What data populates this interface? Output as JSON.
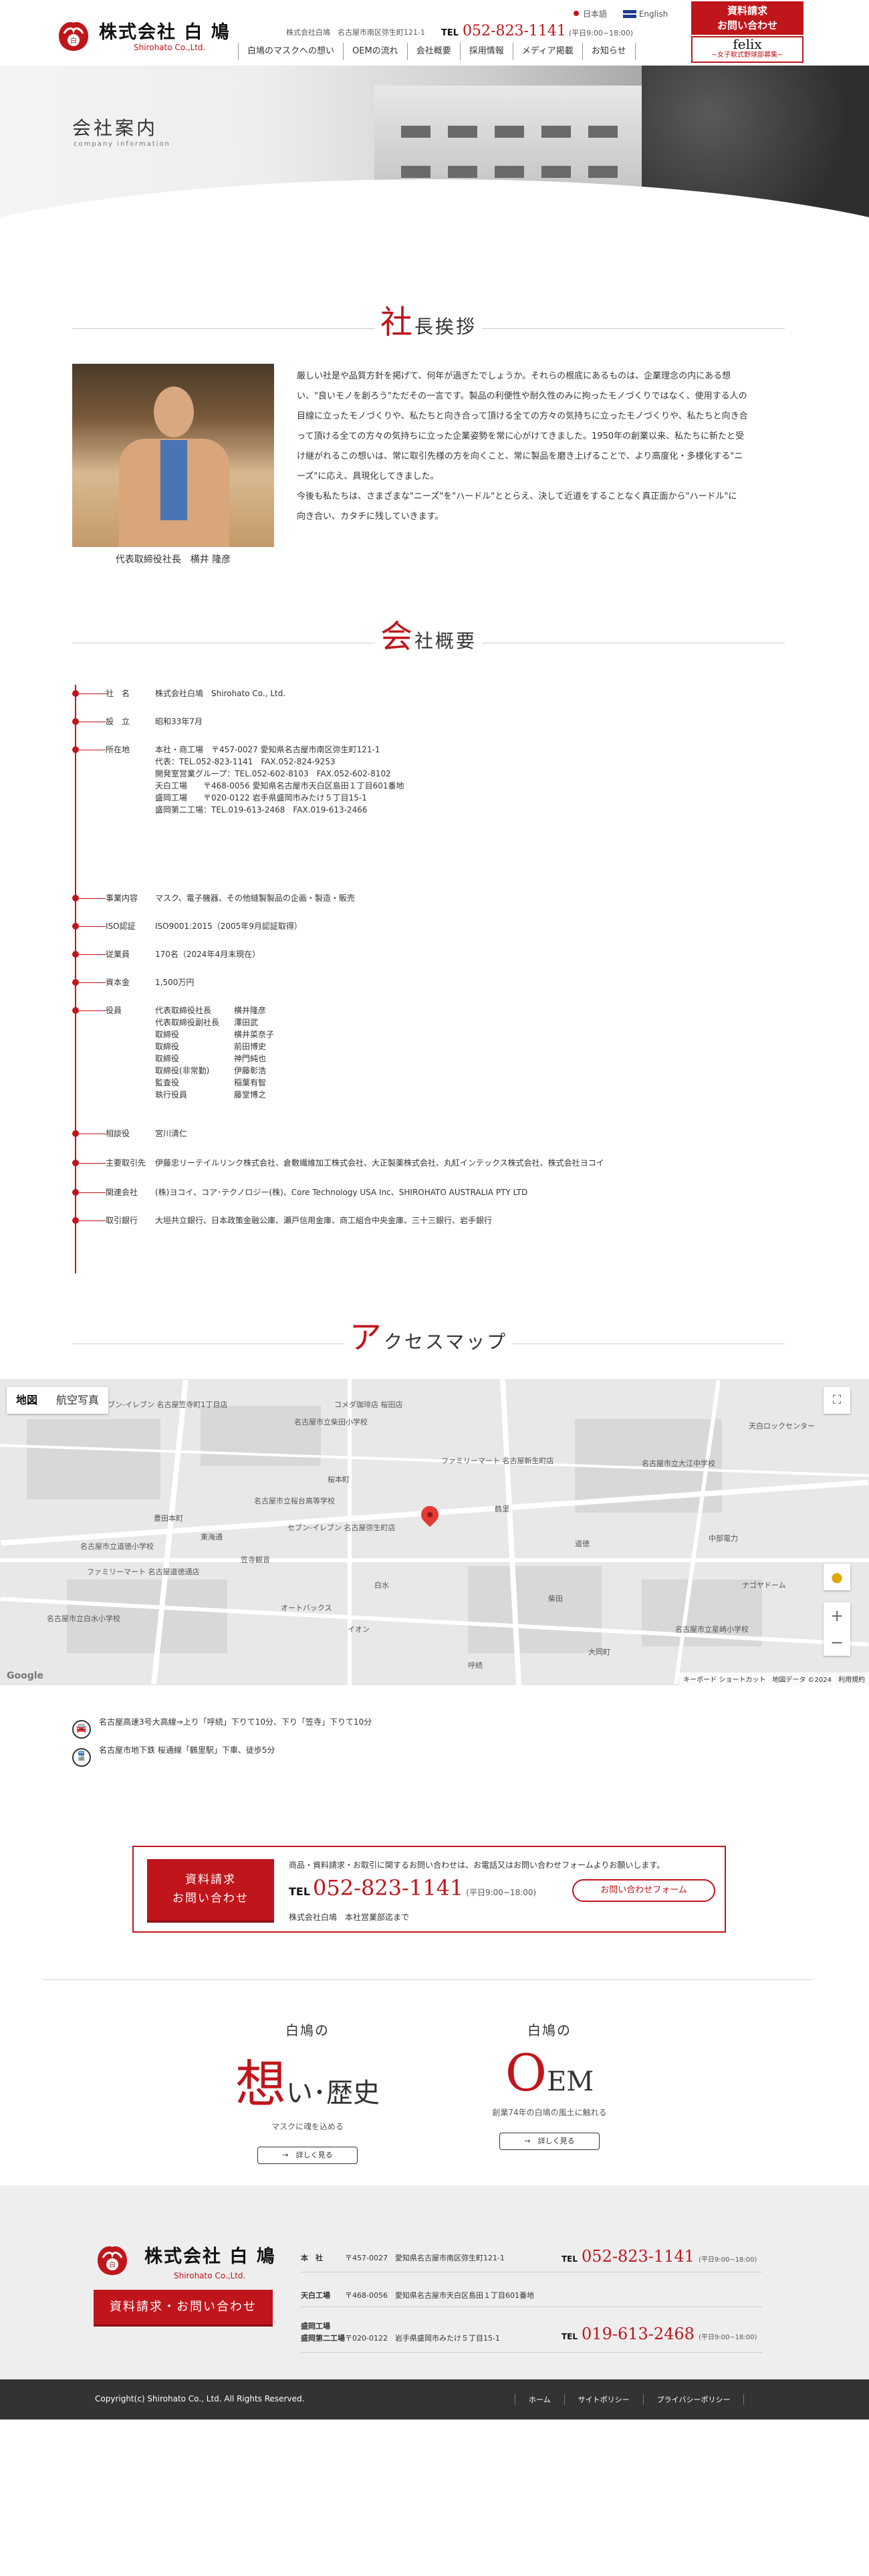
{
  "header": {
    "company_name": "株式会社 白 鳩",
    "company_name_en": "Shirohato Co.,Ltd.",
    "lang_ja": "日本語",
    "lang_en": "English",
    "address": "株式会社白鳩　名古屋市南区弥生町121-1",
    "tel_label": "TEL",
    "tel": "052-823-1141",
    "tel_hours": "(平日9:00~18:00)",
    "cta_line1": "資料請求",
    "cta_line2": "お問い合わせ",
    "felix_title": "felix",
    "felix_sub": "~女子軟式野球部募集~",
    "nav": [
      "白鳩のマスクへの想い",
      "OEMの流れ",
      "会社概要",
      "採用情報",
      "メディア掲載",
      "お知らせ"
    ]
  },
  "hero": {
    "title": "会社案内",
    "subtitle": "company information"
  },
  "greeting": {
    "heading_initial": "社",
    "heading_rest": "長挨拶",
    "caption": "代表取締役社長　横井 隆彦",
    "lines": [
      "厳しい社是や品質方針を掲げて、何年が過ぎたでしょうか。それらの根底にあるものは、企業理念の内にある想",
      "い、\"良いモノを創ろう\"ただその一言です。製品の利便性や耐久性のみに拘ったモノづくりではなく、使用する人の",
      "目線に立ったモノづくりや、私たちと向き合って頂ける全ての方々の気持ちに立ったモノづくりや、私たちと向き合",
      "って頂ける全ての方々の気持ちに立った企業姿勢を常に心がけてきました。1950年の創業以来、私たちに新たと受",
      "け継がれるこの想いは、常に取引先様の方を向くこと、常に製品を磨き上げることで、より高度化・多様化する\"ニ",
      "ーズ\"に応え、具現化してきました。",
      "今後も私たちは、さまざまな\"ニーズ\"を\"ハードル\"ととらえ、決して近道をすることなく真正面から\"ハードル\"に",
      "向き合い、カタチに残していきます。"
    ]
  },
  "overview": {
    "heading_initial": "会",
    "heading_rest": "社概要",
    "rows": [
      {
        "k": "社　名",
        "v": [
          "株式会社白鳩　Shirohato Co., Ltd."
        ]
      },
      {
        "k": "設　立",
        "v": [
          "昭和33年7月"
        ]
      },
      {
        "k": "所在地",
        "v": [
          "本社・商工場　〒457-0027 愛知県名古屋市南区弥生町121-1",
          "代表：TEL.052-823-1141　FAX.052-824-9253",
          "開発室営業グループ：TEL.052-602-8103　FAX.052-602-8102",
          "",
          "天白工場　　〒468-0056 愛知県名古屋市天白区島田１丁目601番地",
          "",
          "盛岡工場　　〒020-0122 岩手県盛岡市みたけ５丁目15-1",
          "盛岡第二工場：TEL.019-613-2468　FAX.019-613-2466"
        ]
      },
      {
        "k": "事業内容",
        "v": [
          "マスク、電子機器、その他縫製製品の企画・製造・販売"
        ]
      },
      {
        "k": "ISO認証",
        "v": [
          "ISO9001:2015（2005年9月認証取得）"
        ]
      },
      {
        "k": "従業員",
        "v": [
          "170名（2024年4月末現在）"
        ]
      },
      {
        "k": "資本金",
        "v": [
          "1,500万円"
        ]
      },
      {
        "k": "役員",
        "officers": [
          [
            "代表取締役社長",
            "横井隆彦"
          ],
          [
            "代表取締役副社長",
            "澤田武"
          ],
          [
            "取締役",
            "横井菜奈子"
          ],
          [
            "取締役",
            "前田博史"
          ],
          [
            "取締役",
            "神門純也"
          ],
          [
            "取締役(非常勤)",
            "伊藤彰浩"
          ],
          [
            "監査役",
            "稲葉有智"
          ],
          [
            "執行役員",
            "藤堂博之"
          ]
        ]
      },
      {
        "k": "相談役",
        "v": [
          "宮川清仁"
        ]
      },
      {
        "k": "主要取引先",
        "v": [
          "伊藤忠リーテイルリンク株式会社、倉敷繊維加工株式会社、大正製薬株式会社、丸紅インテックス株式会社、株式会社ヨコイ"
        ]
      },
      {
        "k": "関連会社",
        "v": [
          "(株)ヨコイ、コア･テクノロジー(株)、Core Technology USA Inc、SHIROHATO AUSTRALIA PTY LTD"
        ]
      },
      {
        "k": "取引銀行",
        "v": [
          "大垣共立銀行、日本政策金融公庫、瀬戸信用金庫、商工組合中央金庫、三十三銀行、岩手銀行"
        ]
      }
    ]
  },
  "access": {
    "heading_initial": "ア",
    "heading_rest": "クセスマップ",
    "map_tab_map": "地図",
    "map_tab_sat": "航空写真",
    "map_attr": "キーボード ショートカット　地図データ ©2024　利用規約",
    "map_google": "Google",
    "map_labels": [
      "セブン-イレブン 名古屋笠寺町1丁目店",
      "コメダ珈琲店 桜田店",
      "名古屋市立柴田小学校",
      "天白ロックセンター",
      "ファミリーマート 名古屋新生町店",
      "名古屋市立大江中学校",
      "桜本町",
      "名古屋市立桜台高等学校",
      "セブン-イレブン 名古屋弥生町店",
      "名古屋市立道徳小学校",
      "ファミリーマート 名古屋道徳通店",
      "オートバックス",
      "イオン",
      "呼続",
      "笠寺観音",
      "東海通",
      "道徳",
      "鶴里",
      "柴田",
      "大同町",
      "中部電力",
      "豊田本町",
      "名古屋市立白水小学校",
      "名古屋市立星崎小学校",
      "白水",
      "ナゴヤドーム"
    ],
    "lines": [
      "名古屋高速3号大高線⇒上り「呼続」下りて10分、下り「笠寺」下りて10分",
      "名古屋市地下鉄 桜通線「鶴里駅」下車、徒歩5分"
    ]
  },
  "contact": {
    "btn_line1": "資料請求",
    "btn_line2": "お問い合わせ",
    "lead": "商品・資料請求・お取引に関するお問い合わせは、お電話又はお問い合わせフォームよりお願いします。",
    "tel_label": "TEL",
    "tel": "052-823-1141",
    "tel_hours": "(平日9:00~18:00)",
    "form_label": "お問い合わせフォーム",
    "note": "株式会社白鳩　本社営業部迄まで"
  },
  "features": [
    {
      "label": "白鳩の",
      "big_initial": "想",
      "big_rest": "い･歴史",
      "desc": "マスクに魂を込める",
      "more": "→　詳しく見る"
    },
    {
      "label": "白鳩の",
      "big_initial": "O",
      "big_rest": "EM",
      "desc": "創業74年の白鳩の風土に触れる",
      "more": "→　詳しく見る"
    }
  ],
  "footer": {
    "company_name": "株式会社 白 鳩",
    "company_name_en": "Shirohato Co.,Ltd.",
    "cta": "資料請求・お問い合わせ",
    "offices": [
      {
        "k": "本　社",
        "a": "〒457-0027　愛知県名古屋市南区弥生町121-1",
        "tel_label": "TEL",
        "tel": "052-823-1141",
        "hours": "(平日9:00~18:00)"
      },
      {
        "k": "天白工場",
        "a": "〒468-0056　愛知県名古屋市天白区島田１丁目601番地",
        "tel_label": "",
        "tel": "",
        "hours": ""
      },
      {
        "k": "盛岡工場\n盛岡第二工場",
        "a": "〒020-0122　岩手県盛岡市みたけ５丁目15-1",
        "tel_label": "TEL",
        "tel": "019-613-2468",
        "hours": "(平日9:00~18:00)"
      }
    ],
    "copyright": "Copyright(c) Shirohato Co., Ltd. All Rights Reserved.",
    "links": [
      "ホーム",
      "サイトポリシー",
      "プライバシーポリシー"
    ]
  }
}
